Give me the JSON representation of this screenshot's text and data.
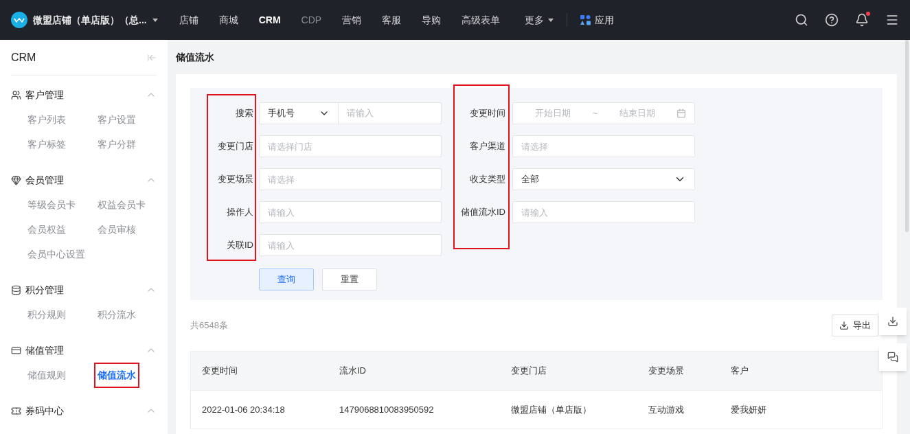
{
  "topbar": {
    "store_name": "微盟店铺（单店版）（总...",
    "nav": [
      {
        "label": "店铺",
        "selected": false
      },
      {
        "label": "商城",
        "selected": false
      },
      {
        "label": "CRM",
        "selected": true
      },
      {
        "label": "CDP",
        "selected": false,
        "disabled": true
      },
      {
        "label": "营销",
        "selected": false
      },
      {
        "label": "客服",
        "selected": false
      },
      {
        "label": "导购",
        "selected": false
      },
      {
        "label": "高级表单",
        "selected": false
      }
    ],
    "more": "更多",
    "apps": "应用",
    "has_notification": true
  },
  "sidebar": {
    "title": "CRM",
    "groups": [
      {
        "title": "客户管理",
        "expanded": true,
        "items": [
          {
            "label": "客户列表",
            "selected": false,
            "highlighted": false
          },
          {
            "label": "客户设置",
            "selected": false,
            "highlighted": false
          },
          {
            "label": "客户标签",
            "selected": false,
            "highlighted": false
          },
          {
            "label": "客户分群",
            "selected": false,
            "highlighted": false
          }
        ]
      },
      {
        "title": "会员管理",
        "expanded": true,
        "items": [
          {
            "label": "等级会员卡",
            "selected": false,
            "highlighted": false
          },
          {
            "label": "权益会员卡",
            "selected": false,
            "highlighted": false
          },
          {
            "label": "会员权益",
            "selected": false,
            "highlighted": false
          },
          {
            "label": "会员审核",
            "selected": false,
            "highlighted": false
          },
          {
            "label": "会员中心设置",
            "selected": false,
            "highlighted": false
          }
        ]
      },
      {
        "title": "积分管理",
        "expanded": true,
        "items": [
          {
            "label": "积分规则",
            "selected": false,
            "highlighted": false
          },
          {
            "label": "积分流水",
            "selected": false,
            "highlighted": false
          }
        ]
      },
      {
        "title": "储值管理",
        "expanded": true,
        "items": [
          {
            "label": "储值规则",
            "selected": false,
            "highlighted": false
          },
          {
            "label": "储值流水",
            "selected": true,
            "highlighted": true
          }
        ]
      },
      {
        "title": "券码中心",
        "expanded": true
      }
    ]
  },
  "page_title": "储值流水",
  "filter_columns": [
    {
      "highlighted": true,
      "fields": [
        {
          "kind": "select-input",
          "label": "搜索",
          "value": "手机号",
          "placeholder": "请输入"
        },
        {
          "kind": "input",
          "label": "变更门店",
          "placeholder": "请选择门店"
        },
        {
          "kind": "input",
          "label": "变更场景",
          "placeholder": "请选择"
        },
        {
          "kind": "input",
          "label": "操作人",
          "placeholder": "请输入"
        },
        {
          "kind": "input",
          "label": "关联ID",
          "placeholder": "请输入"
        }
      ]
    },
    {
      "highlighted": true,
      "fields": [
        {
          "kind": "date-range",
          "label": "变更时间",
          "start_placeholder": "开始日期",
          "separator": "~",
          "end_placeholder": "结束日期"
        },
        {
          "kind": "input",
          "label": "客户渠道",
          "placeholder": "请选择"
        },
        {
          "kind": "select",
          "label": "收支类型",
          "value": "全部"
        },
        {
          "kind": "input",
          "label": "储值流水ID",
          "placeholder": "请输入"
        }
      ]
    }
  ],
  "buttons": {
    "query": "查询",
    "reset": "重置"
  },
  "total": "共6548条",
  "export": "导出",
  "table": {
    "columns": [
      "变更时间",
      "流水ID",
      "变更门店",
      "变更场景",
      "客户"
    ],
    "rows": [
      [
        "2022-01-06 20:34:18",
        "1479068810083950592",
        "微盟店铺（单店版）",
        "互动游戏",
        "爱我妍妍"
      ]
    ]
  }
}
